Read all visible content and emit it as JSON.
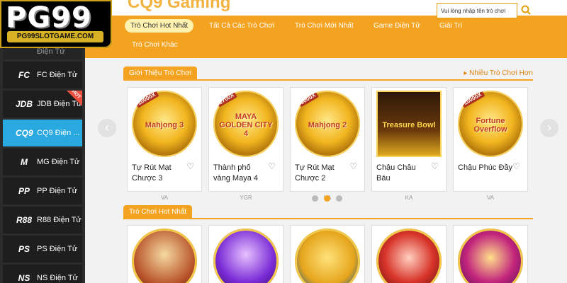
{
  "logo": {
    "main": "PG99",
    "sub": "PG99SLOTGAME.COM"
  },
  "brand": {
    "text": "CQ9 Gaming"
  },
  "search": {
    "placeholder": "Vui lòng nhập tên trò chơi"
  },
  "nav": {
    "items": [
      "Trò Chơi Hot Nhất",
      "Tất Cả Các Trò Chơi",
      "Trò Chơi Mới Nhất",
      "Game Điện Tử",
      "Giải Trí",
      "Trò Chơi Khác"
    ]
  },
  "sidebar": {
    "items": [
      {
        "icon": "",
        "label": "Điện Tử"
      },
      {
        "icon": "FC",
        "label": "FC Điện Tử"
      },
      {
        "icon": "JDB",
        "label": "JDB Điện Tử",
        "badge": "HOT"
      },
      {
        "icon": "CQ9",
        "label": "CQ9 Điện ..."
      },
      {
        "icon": "M",
        "label": "MG Điện Tử"
      },
      {
        "icon": "PP",
        "label": "PP Điện Tử"
      },
      {
        "icon": "R88",
        "label": "R88 Điện Tử"
      },
      {
        "icon": "PS",
        "label": "PS Điện Tử"
      },
      {
        "icon": "NS",
        "label": "NS Điện Tử"
      }
    ]
  },
  "section1": {
    "title": "Giới Thiệu Trò Chơi",
    "more": "Nhiều Trò Chơi Hơn",
    "games": [
      {
        "name": "Tự Rút Mạt Chược 3",
        "provider": "VA",
        "emblem": "Mahjong 3",
        "tag": "10000X"
      },
      {
        "name": "Thành phố vàng Maya 4",
        "provider": "YGR",
        "emblem": "MAYA GOLDEN CITY 4",
        "tag": "1700X"
      },
      {
        "name": "Tự Rút Mạt Chược 2",
        "provider": "VA",
        "emblem": "Mahjong 2",
        "tag": "5000X"
      },
      {
        "name": "Chậu Châu Báu",
        "provider": "KA",
        "emblem": "Treasure Bowl",
        "tag": ""
      },
      {
        "name": "Chậu Phúc Đầy",
        "provider": "VA",
        "emblem": "Fortune Overflow",
        "tag": "10000X"
      }
    ]
  },
  "section2": {
    "title": "Trò Chơi Hot Nhất"
  },
  "colors": {
    "accent": "#f3a31f",
    "active_side": "#2aa8e0",
    "sidebar": "#2b2b2b"
  }
}
